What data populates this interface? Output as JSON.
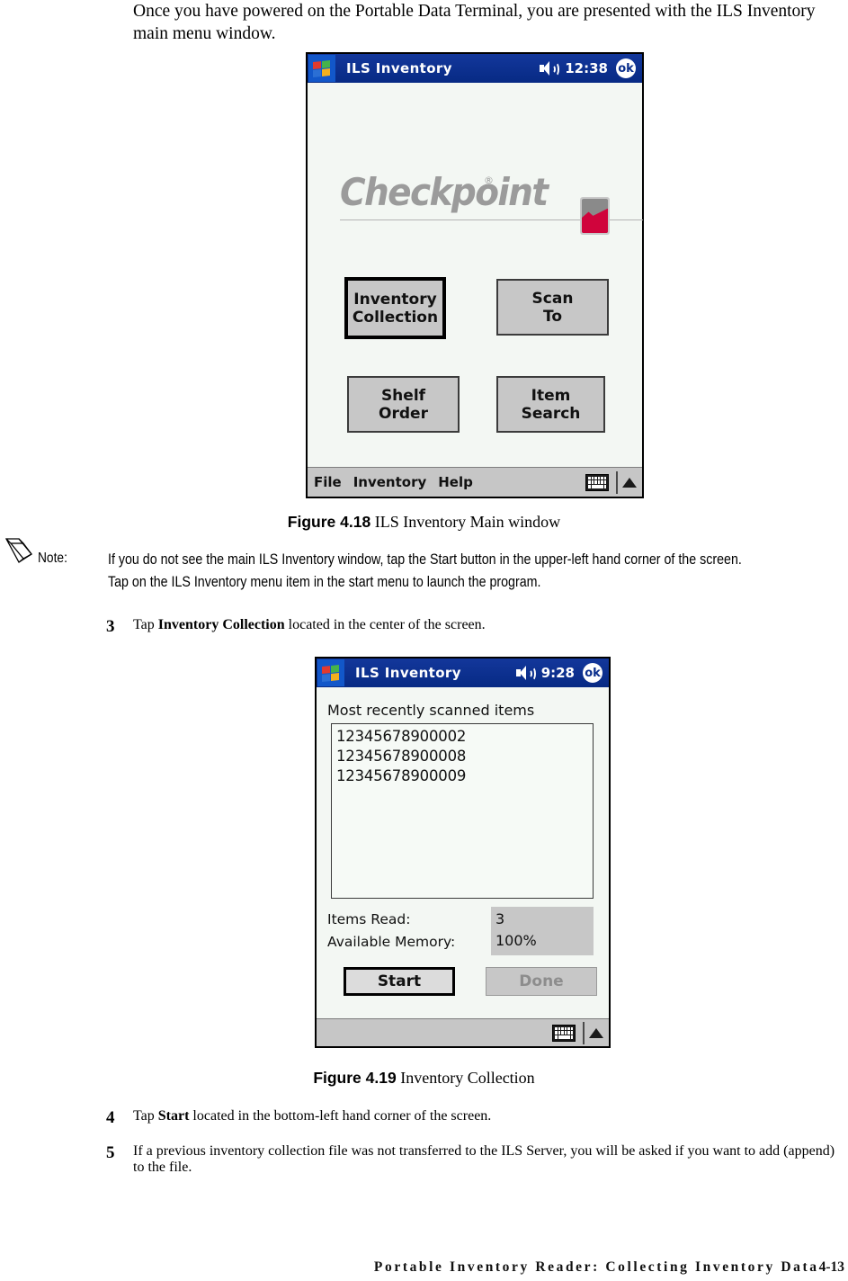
{
  "document": {
    "intro_paragraph": "Once you have powered on the Portable Data Terminal, you are presented with the ILS Inventory main menu window.",
    "figure_1": {
      "label": "Figure 4.18",
      "caption": "ILS Inventory Main window"
    },
    "figure_2": {
      "label": "Figure 4.19",
      "caption": "Inventory Collection"
    },
    "note": {
      "label": "Note:",
      "text": "If you do not see the main ILS Inventory window, tap the Start button in the upper-left hand corner of the screen. Tap on the ILS Inventory menu item in the start menu to launch the program."
    },
    "steps": [
      {
        "number": "3",
        "prefix": "Tap ",
        "bold": "Inventory Collection",
        "suffix": " located in the center of the screen."
      },
      {
        "number": "4",
        "prefix": "Tap ",
        "bold": "Start",
        "suffix": " located in the bottom-left hand corner of the screen."
      },
      {
        "number": "5",
        "prefix": "",
        "bold": "",
        "suffix": "If a previous inventory collection file was not transferred to the ILS Server, you will be asked if you want to add (append) to the file."
      }
    ],
    "footer": {
      "text": "Portable Inventory Reader: Collecting Inventory Data",
      "page": "4-13"
    }
  },
  "pda_main_menu": {
    "titlebar": {
      "app_title": "ILS Inventory",
      "clock": "12:38",
      "ok_label": "ok",
      "icons": {
        "windows_logo": "windows-flag-icon",
        "speaker": "speaker-volume-icon"
      }
    },
    "logo": {
      "wordmark": "Checkpoint",
      "registered": "®"
    },
    "buttons": [
      {
        "id": "inventory-collection",
        "line1": "Inventory",
        "line2": "Collection",
        "state": "focused"
      },
      {
        "id": "scan-to",
        "line1": "Scan",
        "line2": "To",
        "state": "normal"
      },
      {
        "id": "shelf-order",
        "line1": "Shelf",
        "line2": "Order",
        "state": "normal"
      },
      {
        "id": "item-search",
        "line1": "Item",
        "line2": "Search",
        "state": "normal"
      }
    ],
    "menubar": {
      "items": [
        "File",
        "Inventory",
        "Help"
      ],
      "keyboard_icon": "keyboard-icon",
      "arrow_icon": "chevron-up-icon"
    }
  },
  "pda_inventory_collection": {
    "titlebar": {
      "app_title": "ILS Inventory",
      "clock": "9:28",
      "ok_label": "ok"
    },
    "list_label": "Most recently scanned items",
    "scanned_items": [
      "12345678900002",
      "12345678900008",
      "12345678900009"
    ],
    "stats": {
      "items_read_label": "Items Read:",
      "items_read_value": "3",
      "available_memory_label": "Available Memory:",
      "available_memory_value": "100%"
    },
    "buttons": {
      "start": "Start",
      "done": "Done"
    },
    "menubar": {
      "items": [],
      "keyboard_icon": "keyboard-icon",
      "arrow_icon": "chevron-up-icon"
    }
  },
  "colors": {
    "titlebar_blue": "#0a2e8c",
    "pda_background": "#f3f7f3",
    "button_gray": "#c7c7c7",
    "checkpoint_gray": "#9b9b9b",
    "checkpoint_red": "#d0043c"
  }
}
